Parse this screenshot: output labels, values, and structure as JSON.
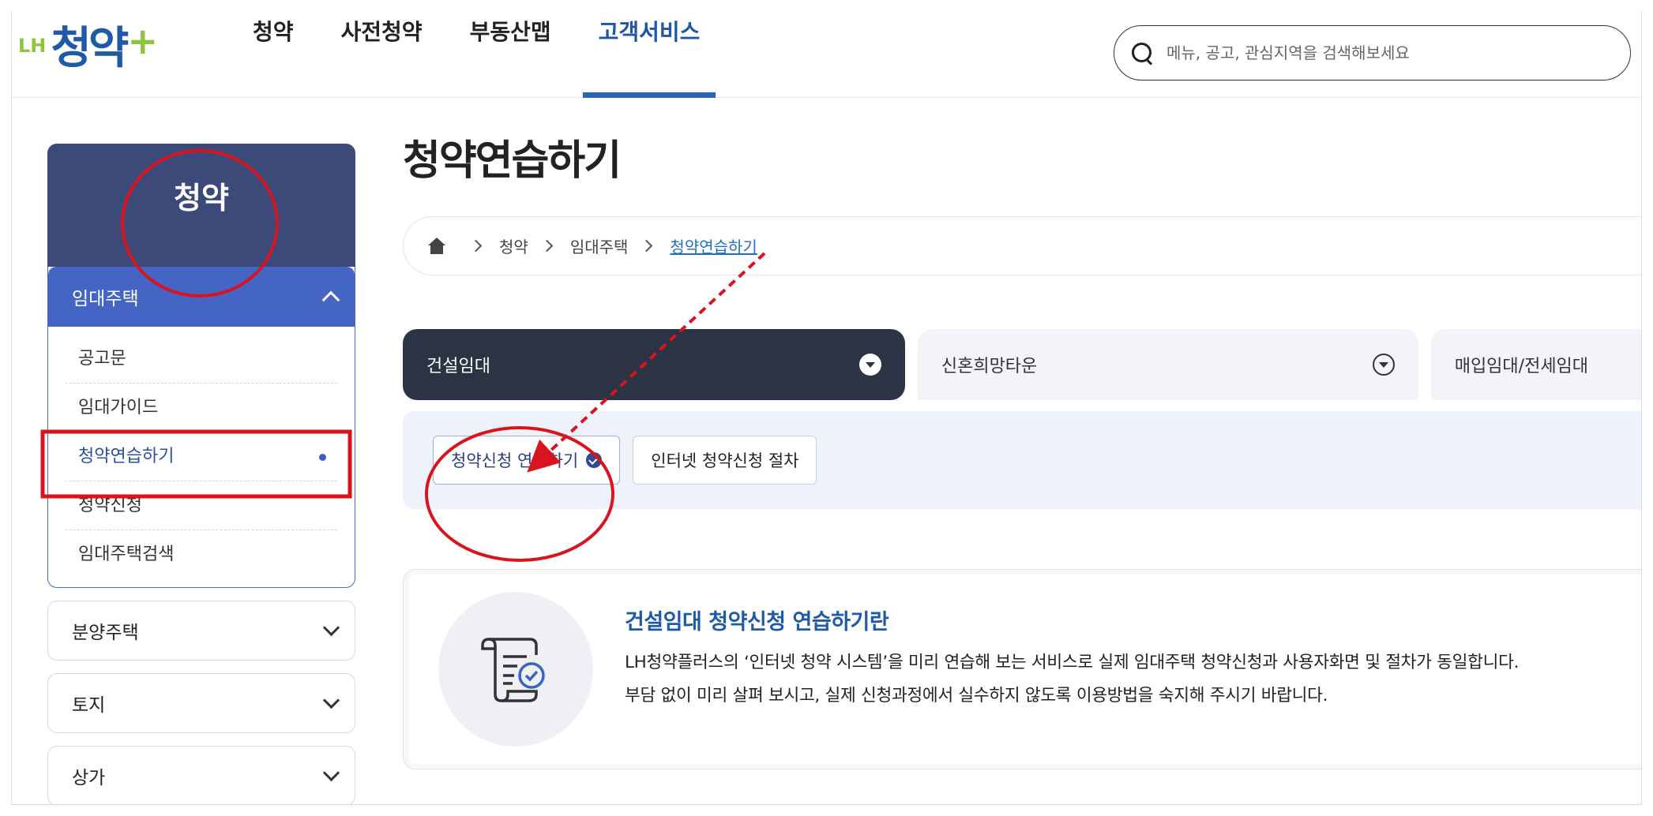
{
  "header": {
    "logo": {
      "prefix": "LH",
      "name": "청약",
      "plus": "+"
    },
    "nav": [
      {
        "label": "청약"
      },
      {
        "label": "사전청약"
      },
      {
        "label": "부동산맵"
      },
      {
        "label": "고객서비스",
        "active": true
      }
    ],
    "search": {
      "placeholder": "메뉴, 공고, 관심지역을 검색해보세요"
    }
  },
  "sidebar": {
    "title": "청약",
    "open_group": {
      "label": "임대주택",
      "items": [
        {
          "label": "공고문"
        },
        {
          "label": "임대가이드"
        },
        {
          "label": "청약연습하기",
          "active": true
        },
        {
          "label": "청약신청"
        },
        {
          "label": "임대주택검색"
        }
      ]
    },
    "groups": [
      {
        "label": "분양주택"
      },
      {
        "label": "토지"
      },
      {
        "label": "상가"
      }
    ]
  },
  "main": {
    "title": "청약연습하기",
    "breadcrumb": [
      "청약",
      "임대주택",
      "청약연습하기"
    ],
    "tabs": [
      {
        "label": "건설임대",
        "active": true
      },
      {
        "label": "신혼희망타운"
      },
      {
        "label": "매입임대/전세임대"
      }
    ],
    "subtabs": [
      {
        "label": "청약신청 연습하기",
        "active": true
      },
      {
        "label": "인터넷 청약신청 절차"
      }
    ],
    "info": {
      "heading": "건설임대 청약신청 연습하기란",
      "line1": "LH청약플러스의 ‘인터넷 청약 시스템’을 미리 연습해 보는 서비스로 실제 임대주택 청약신청과 사용자화면 및 절차가 동일합니다.",
      "line2": "부담 없이 미리 살펴 보시고, 실제 신청과정에서 실수하지 않도록 이용방법을 숙지해 주시기 바랍니다."
    }
  },
  "colors": {
    "brand_blue": "#1f5aa6",
    "brand_green": "#8cc63f",
    "sidebar_navy": "#3b4a78",
    "sidebar_active": "#4565c4",
    "tab_active": "#2c3344",
    "annotation_red": "#d9141e"
  }
}
